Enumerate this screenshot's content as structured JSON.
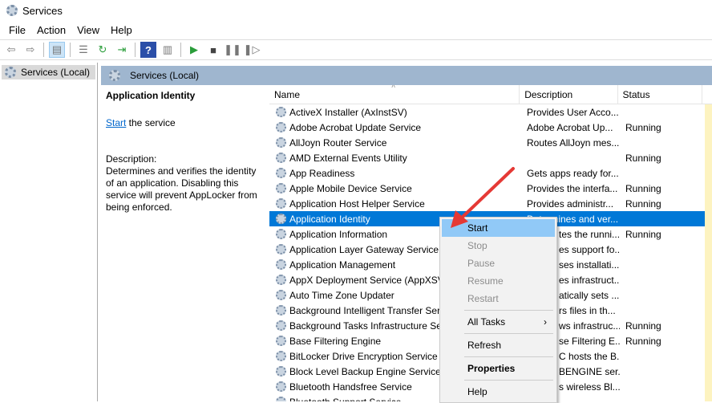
{
  "window": {
    "title": "Services"
  },
  "menu": [
    "File",
    "Action",
    "View",
    "Help"
  ],
  "tree": {
    "item": "Services (Local)"
  },
  "pane_header": "Services (Local)",
  "detail": {
    "title": "Application Identity",
    "start_link": "Start",
    "start_suffix": " the service",
    "desc_label": "Description:",
    "desc_text": "Determines and verifies the identity of an application. Disabling this service will prevent AppLocker from being enforced."
  },
  "columns": [
    "Name",
    "Description",
    "Status"
  ],
  "rows": [
    {
      "name": "ActiveX Installer (AxInstSV)",
      "desc": "Provides User Acco...",
      "status": ""
    },
    {
      "name": "Adobe Acrobat Update Service",
      "desc": "Adobe Acrobat Up...",
      "status": "Running"
    },
    {
      "name": "AllJoyn Router Service",
      "desc": "Routes AllJoyn mes...",
      "status": ""
    },
    {
      "name": "AMD External Events Utility",
      "desc": "",
      "status": "Running"
    },
    {
      "name": "App Readiness",
      "desc": "Gets apps ready for...",
      "status": ""
    },
    {
      "name": "Apple Mobile Device Service",
      "desc": "Provides the interfa...",
      "status": "Running"
    },
    {
      "name": "Application Host Helper Service",
      "desc": "Provides administr...",
      "status": "Running"
    },
    {
      "name": "Application Identity",
      "desc": "Determines and ver...",
      "status": ""
    },
    {
      "name": "Application Information",
      "desc": "tes the runni...",
      "status": "Running"
    },
    {
      "name": "Application Layer Gateway Service",
      "desc": "es support fo...",
      "status": ""
    },
    {
      "name": "Application Management",
      "desc": "ses installati...",
      "status": ""
    },
    {
      "name": "AppX Deployment Service (AppXSV",
      "desc": "es infrastruct...",
      "status": ""
    },
    {
      "name": "Auto Time Zone Updater",
      "desc": "atically sets ...",
      "status": ""
    },
    {
      "name": "Background Intelligent Transfer Ser",
      "desc": "rs files in th...",
      "status": ""
    },
    {
      "name": "Background Tasks Infrastructure Ser",
      "desc": "ws infrastruc...",
      "status": "Running"
    },
    {
      "name": "Base Filtering Engine",
      "desc": "se Filtering E...",
      "status": "Running"
    },
    {
      "name": "BitLocker Drive Encryption Service",
      "desc": "C hosts the B...",
      "status": ""
    },
    {
      "name": "Block Level Backup Engine Service",
      "desc": "BENGINE ser...",
      "status": ""
    },
    {
      "name": "Bluetooth Handsfree Service",
      "desc": "s wireless Bl...",
      "status": ""
    },
    {
      "name": "Bluetooth Support Service",
      "desc": "",
      "status": ""
    }
  ],
  "context_menu": {
    "start": "Start",
    "stop": "Stop",
    "pause": "Pause",
    "resume": "Resume",
    "restart": "Restart",
    "all_tasks": "All Tasks",
    "refresh": "Refresh",
    "properties": "Properties",
    "help": "Help"
  },
  "colors": {
    "selection": "#0078d7",
    "menu_highlight": "#91c9f7",
    "arrow": "#e53935"
  }
}
